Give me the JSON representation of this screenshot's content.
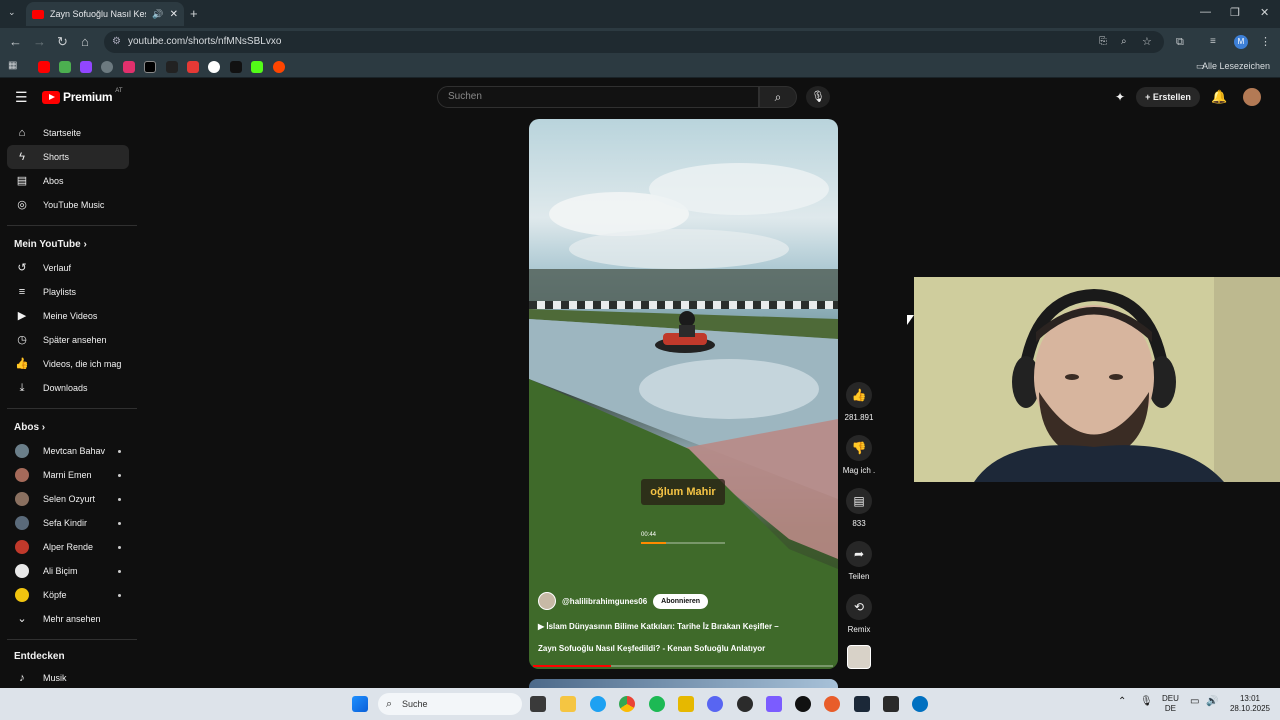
{
  "browser": {
    "tab_title": "Zayn Sofuoğlu Nasıl Keşfedi",
    "url": "youtube.com/shorts/nfMNsSBLvxo",
    "bookmarks_all": "Alle Lesezeichen",
    "profile_initial": "M"
  },
  "header": {
    "logo_text": "Premium",
    "logo_region": "AT",
    "search_placeholder": "Suchen",
    "create_label": "Erstellen"
  },
  "sidebar": {
    "main": [
      {
        "label": "Startseite",
        "icon": "home-icon"
      },
      {
        "label": "Shorts",
        "icon": "shorts-icon"
      },
      {
        "label": "Abos",
        "icon": "subscriptions-icon"
      },
      {
        "label": "YouTube Music",
        "icon": "music-icon"
      }
    ],
    "you_title": "Mein YouTube",
    "you": [
      {
        "label": "Verlauf",
        "icon": "history-icon"
      },
      {
        "label": "Playlists",
        "icon": "playlists-icon"
      },
      {
        "label": "Meine Videos",
        "icon": "my-videos-icon"
      },
      {
        "label": "Später ansehen",
        "icon": "watch-later-icon"
      },
      {
        "label": "Videos, die ich mag",
        "icon": "liked-icon"
      },
      {
        "label": "Downloads",
        "icon": "download-icon"
      }
    ],
    "subs_title": "Abos",
    "subs": [
      {
        "label": "Mevtcan Bahav",
        "color": "#6b7f8a"
      },
      {
        "label": "Marni Emen",
        "color": "#a56a5a"
      },
      {
        "label": "Selen Ozyurt",
        "color": "#8a7060"
      },
      {
        "label": "Sefa Kindir",
        "color": "#5a6a7a"
      },
      {
        "label": "Alper Rende",
        "color": "#c0392b"
      },
      {
        "label": "Ali Biçim",
        "color": "#e8e8e8"
      },
      {
        "label": "Köpfe",
        "color": "#f1c40f"
      }
    ],
    "more_label": "Mehr ansehen",
    "explore_title": "Entdecken",
    "explore": [
      {
        "label": "Musik",
        "icon": "music-note-icon"
      }
    ]
  },
  "short": {
    "caption": "oğlum Mahir",
    "timestamp": "00:44",
    "channel": "@halilibrahimgunes06",
    "subscribe_label": "Abonnieren",
    "title_line1": "İslam Dünyasının Bilime Katkıları: Tarihe İz Bırakan Keşifler –",
    "title_line2": "Zayn Sofuoğlu Nasıl Keşfedildi? - Kenan Sofuoğlu Anlatıyor",
    "progress": 0.26
  },
  "actions": {
    "likes": "281.891",
    "dislike_label": "Mag ich .",
    "comments": "833",
    "share_label": "Teilen",
    "remix_label": "Remix"
  },
  "taskbar": {
    "search_label": "Suche",
    "lang_top": "DEU",
    "lang_bottom": "DE",
    "time": "13:01",
    "date": "28.10.2025"
  }
}
